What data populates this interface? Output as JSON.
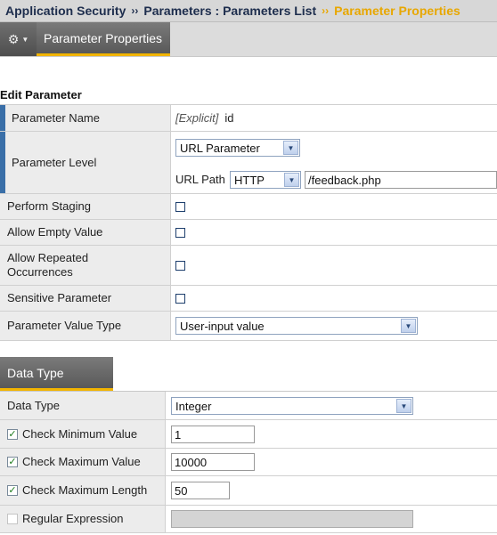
{
  "breadcrumb": {
    "items": [
      "Application Security",
      "Parameters : Parameters List",
      "Parameter Properties"
    ],
    "separator": "››"
  },
  "tabs": {
    "gear_icon": "gear-icon",
    "active": "Parameter Properties"
  },
  "section_title": "Edit Parameter",
  "rows": {
    "name": {
      "label": "Parameter Name",
      "prefix": "[Explicit]",
      "value": "id"
    },
    "level": {
      "label": "Parameter Level",
      "select": "URL Parameter",
      "url_path_label": "URL Path",
      "protocol": "HTTP",
      "path": "/feedback.php"
    },
    "staging": {
      "label": "Perform Staging",
      "checked": false
    },
    "empty": {
      "label": "Allow Empty Value",
      "checked": false
    },
    "repeated": {
      "label": "Allow Repeated Occurrences",
      "checked": false
    },
    "sensitive": {
      "label": "Sensitive Parameter",
      "checked": false
    },
    "value_type": {
      "label": "Parameter Value Type",
      "select": "User-input value"
    }
  },
  "data_type_tab": "Data Type",
  "data_type": {
    "type_row": {
      "label": "Data Type",
      "select": "Integer"
    },
    "check_min": {
      "label": "Check Minimum Value",
      "checked": true,
      "value": "1"
    },
    "check_max": {
      "label": "Check Maximum Value",
      "checked": true,
      "value": "10000"
    },
    "check_len": {
      "label": "Check Maximum Length",
      "checked": true,
      "value": "50"
    },
    "regex": {
      "label": "Regular Expression",
      "checked": false,
      "value": ""
    }
  },
  "colors": {
    "breadcrumb_text": "#1d2d4d",
    "breadcrumb_active": "#e8a700",
    "tab_underline": "#f2b400",
    "required_marker": "#3a6fa8"
  }
}
